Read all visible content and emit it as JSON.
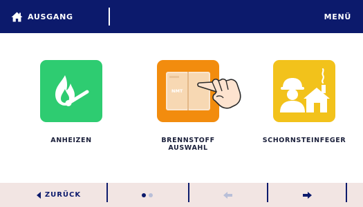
{
  "header": {
    "home_label": "AUSGANG",
    "menu_label": "MENÜ",
    "background": "#0c1a6c",
    "home_icon": "home-icon"
  },
  "tiles": [
    {
      "label": "ANHEIZEN",
      "color": "#2ecc71",
      "icon": "flame-match-icon"
    },
    {
      "label_line1": "BRENNSTOFF",
      "label_line2": "AUSWAHL",
      "color": "#f28c0e",
      "icon": "fuel-book-icon",
      "book_text": "NMT",
      "cursor_icon": "hand-pointer-icon"
    },
    {
      "label": "SCHORNSTEINFEGER",
      "color": "#f2c21b",
      "icon": "chimney-sweep-icon"
    }
  ],
  "bottom_bar": {
    "back_label": "ZURÜCK",
    "back_icon": "chevron-left-icon",
    "page_indicator": {
      "pages": 2,
      "current": 1
    },
    "prev_icon": "arrow-left-icon",
    "next_icon": "arrow-right-icon",
    "background": "#f2e5e3"
  }
}
